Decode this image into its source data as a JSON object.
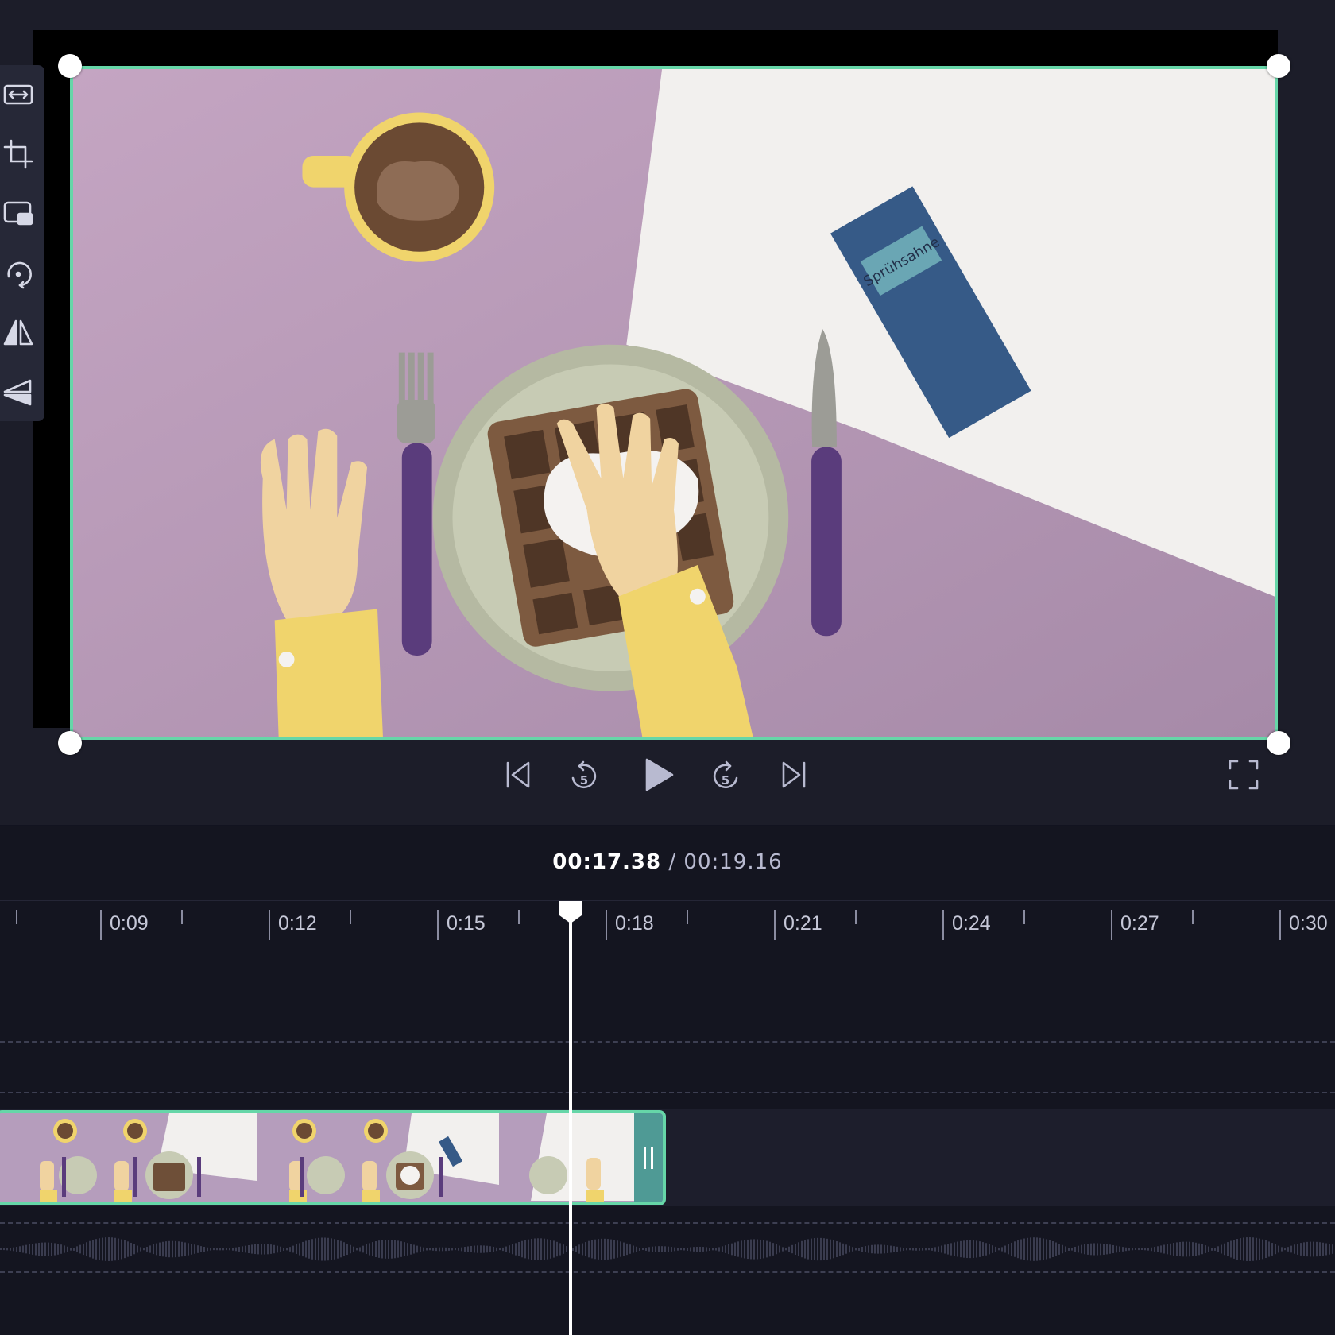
{
  "preview": {
    "image_label": "Sprühsahne"
  },
  "toolbar": {
    "tools": [
      {
        "icon": "fit-arrows-icon"
      },
      {
        "icon": "crop-icon"
      },
      {
        "icon": "picture-in-picture-icon"
      },
      {
        "icon": "rotate-icon"
      },
      {
        "icon": "flip-horizontal-icon"
      },
      {
        "icon": "flip-vertical-icon"
      }
    ]
  },
  "controls": {
    "icons": [
      "skip-back-icon",
      "rewind-5-icon",
      "play-icon",
      "forward-5-icon",
      "skip-forward-icon",
      "fullscreen-icon"
    ],
    "skip_seconds": "5"
  },
  "timecode": {
    "current": "00:17.38",
    "separator": " / ",
    "total": "00:19.16"
  },
  "ruler": {
    "labels": [
      "0:09",
      "0:12",
      "0:15",
      "0:18",
      "0:21",
      "0:24",
      "0:27",
      "0:30"
    ]
  },
  "colors": {
    "accent": "#66d6a8",
    "background": "#1c1d29",
    "timeline_background": "#141520"
  }
}
